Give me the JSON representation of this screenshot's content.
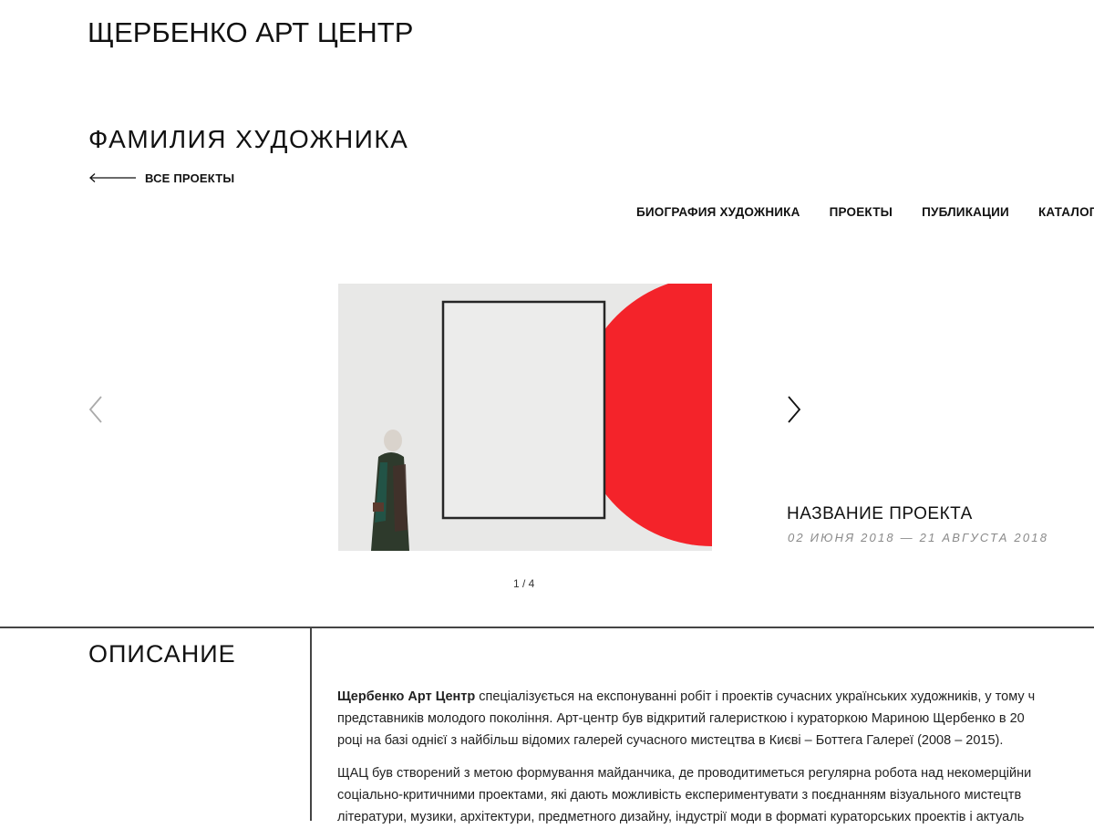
{
  "header": {
    "site_title": "ЩЕРБЕНКО АРТ ЦЕНТР"
  },
  "artist": {
    "name": "ФАМИЛИЯ ХУДОЖНИКА",
    "back_label": "ВСЕ ПРОЕКТЫ"
  },
  "tabs": [
    {
      "label": "БИОГРАФИЯ ХУДОЖНИКА"
    },
    {
      "label": "ПРОЕКТЫ"
    },
    {
      "label": "ПУБЛИКАЦИИ"
    },
    {
      "label": "КАТАЛОГИ"
    }
  ],
  "slider": {
    "project_title": "НАЗВАНИЕ ПРОЕКТА",
    "project_dates": "02 ИЮНЯ 2018 — 21 АВГУСТА 2018",
    "counter": "1 / 4",
    "prev_icon": "chevron-left-icon",
    "next_icon": "chevron-right-icon"
  },
  "description": {
    "heading": "ОПИСАНИЕ",
    "p1_bold": "Щербенко Арт Центр",
    "p1_line1": " спеціалізується на експонуванні робіт і проектів сучасних українських художників, у тому ч",
    "p1_line2": "представників молодого покоління. Арт-центр був відкритий галеристкою і кураторкою Мариною Щербенко в 20",
    "p1_line3": "році на базі однієї з найбільш відомих галерей сучасного мистецтва в Києві – Боттега Галереї (2008 – 2015).",
    "p2_line1": "ЩАЦ був створений з метою формування майданчика, де проводитиметься регулярна робота над некомерційни",
    "p2_line2": "соціально-критичними проектами, які дають можливість експериментувати з поєднанням візуального мистецтв",
    "p2_line3": "літератури, музики, архітектури, предметного дизайну, індустрії моди в форматі кураторських проектів і актуаль"
  },
  "colors": {
    "accent_red": "#f4232a",
    "text": "#111111",
    "muted": "#8a8a8a"
  }
}
